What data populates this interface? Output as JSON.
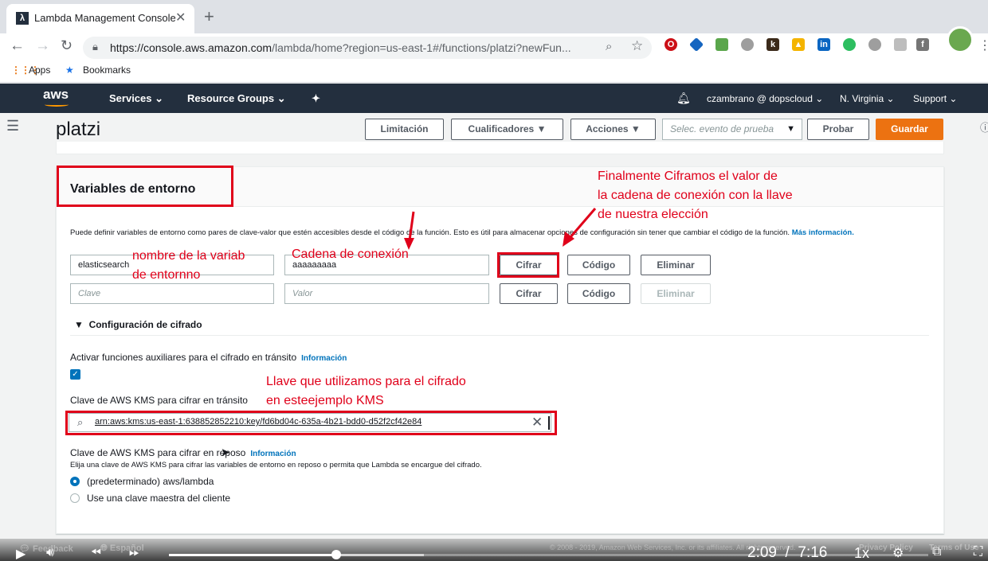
{
  "browser": {
    "tab_title": "Lambda Management Console",
    "url_domain": "https://console.aws.amazon.com",
    "url_path": "/lambda/home?region=us-east-1#/functions/platzi?newFun...",
    "bookmarks": [
      "Apps",
      "Bookmarks"
    ]
  },
  "aws_header": {
    "logo": "aws",
    "nav": [
      "Services",
      "Resource Groups"
    ],
    "user": "czambrano @ dopscloud",
    "region": "N. Virginia",
    "support": "Support"
  },
  "function": {
    "name": "platzi",
    "buttons": {
      "throttle": "Limitación",
      "qualifiers": "Cualificadores",
      "actions": "Acciones",
      "test_event_placeholder": "Selec. evento de prueba",
      "test": "Probar",
      "save": "Guardar"
    }
  },
  "env_panel": {
    "title": "Variables de entorno",
    "description": "Puede definir variables de entorno como pares de clave-valor que estén accesibles desde el código de la función. Esto es útil para almacenar opciones de configuración sin tener que cambiar el código de la función.",
    "more_info": "Más información.",
    "rows": [
      {
        "key": "elasticsearch",
        "value": "aaaaaaaaa",
        "encrypt": "Cifrar",
        "code": "Código",
        "remove": "Eliminar"
      },
      {
        "key_placeholder": "Clave",
        "value_placeholder": "Valor",
        "encrypt": "Cifrar",
        "code": "Código",
        "remove": "Eliminar"
      }
    ],
    "encryption": {
      "section_title": "Configuración de cifrado",
      "helpers_label": "Activar funciones auxiliares para el cifrado en tránsito",
      "info": "Información",
      "helpers_checked": true,
      "transit_key_label": "Clave de AWS KMS para cifrar en tránsito",
      "transit_key_value": "arn:aws:kms:us-east-1:638852852210:key/fd6bd04c-635a-4b21-bdd0-d52f2cf42e84",
      "rest_key_label": "Clave de AWS KMS para cifrar en reposo",
      "rest_key_info": "Información",
      "rest_key_desc": "Elija una clave de AWS KMS para cifrar las variables de entorno en reposo o permita que Lambda se encargue del cifrado.",
      "options": [
        "(predeterminado) aws/lambda",
        "Use una clave maestra del cliente"
      ],
      "selected": 0
    }
  },
  "annotations": {
    "encrypt_note_1": "Finalmente Ciframos el valor de",
    "encrypt_note_2": "la cadena de conexión con la llave",
    "encrypt_note_3": "de nuestra elección",
    "var_name_1": "nombre de la variab",
    "var_name_2": "de entornno",
    "conn_string": "Cadena de conexión",
    "kms_note_1": "Llave que utilizamos para el cifrado",
    "kms_note_2": "en esteejemplo KMS"
  },
  "video": {
    "feedback": "Feedback",
    "language": "Español",
    "copyright": "© 2008 - 2019, Amazon Web Services, Inc. or its affiliates. All rights reserved.",
    "privacy": "Privacy Policy",
    "terms": "Terms of Use",
    "current_time": "2:09",
    "separator": "/",
    "duration": "7:16",
    "speed": "1x",
    "progress": 0.22,
    "buffered": 0.336
  },
  "colors": {
    "aws_nav": "#232f3e",
    "primary_orange": "#ec7211",
    "annotation_red": "#e0001a",
    "link_blue": "#0073bb"
  }
}
